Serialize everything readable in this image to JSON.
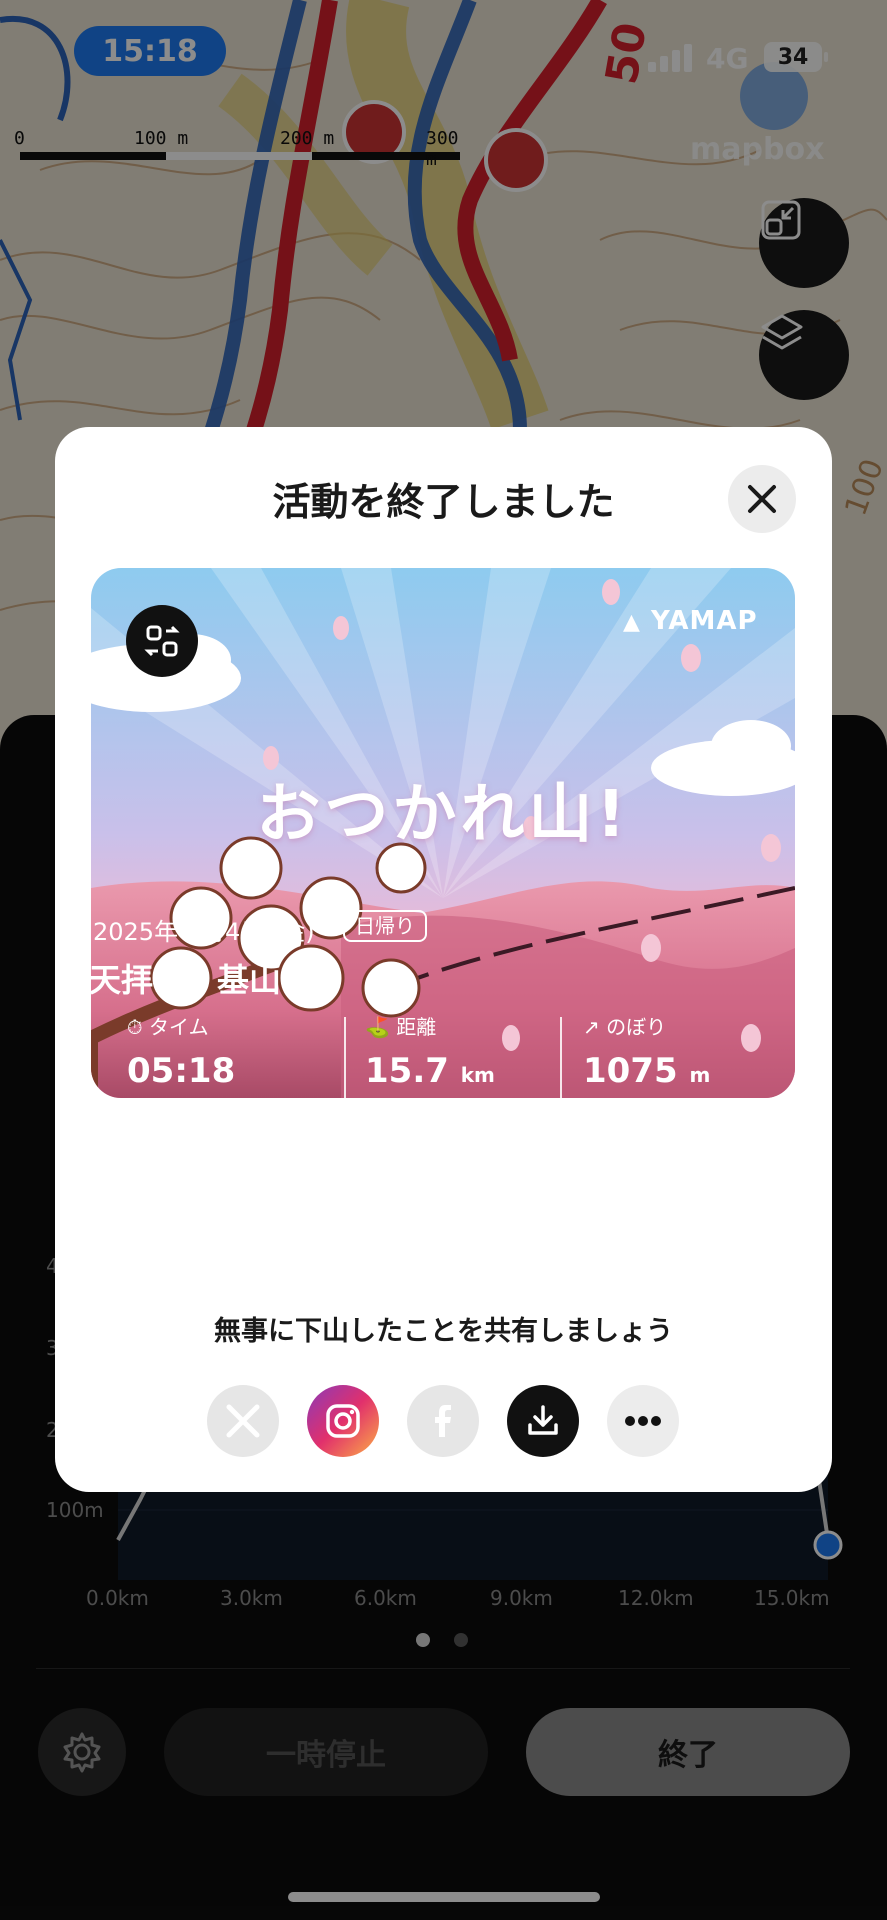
{
  "status_bar": {
    "time": "15:18",
    "network": "4G",
    "battery": "34"
  },
  "map": {
    "scale_labels": [
      "0",
      "100 m",
      "200 m",
      "300 m"
    ],
    "route_marker": "50",
    "contour_label": "100",
    "attribution": "mapbox"
  },
  "panel": {
    "y_axis_labels": [
      "4",
      "3",
      "2",
      "100m"
    ],
    "x_axis_labels": [
      "0.0km",
      "3.0km",
      "6.0km",
      "9.0km",
      "12.0km",
      "15.0km"
    ],
    "page_dots": {
      "count": 2,
      "active": 0
    },
    "pause_label": "一時停止",
    "end_label": "終了"
  },
  "modal": {
    "title": "活動を終了しました",
    "card": {
      "brand": "YAMAP",
      "headline": "おつかれ山!",
      "date": "2025年 4月4日 (金)",
      "trip_type": "日帰り",
      "mountain": "天拝山・基山",
      "stats": [
        {
          "label": "タイム",
          "value": "05:18",
          "unit": ""
        },
        {
          "label": "距離",
          "value": "15.7",
          "unit": "km"
        },
        {
          "label": "のぼり",
          "value": "1075",
          "unit": "m"
        }
      ]
    },
    "share_caption": "無事に下山したことを共有しましょう",
    "share_targets": [
      "x-icon",
      "instagram-icon",
      "facebook-icon",
      "download-icon",
      "more-icon"
    ]
  },
  "colors": {
    "status_pill": "#1e7bf2",
    "route_red": "#d6202d",
    "route_blue": "#2c63b8",
    "sky_top": "#8ecbef",
    "mountain_pink": "#e08aa0",
    "instagram": "#e1306c",
    "end_button": "#8a8a8a"
  }
}
